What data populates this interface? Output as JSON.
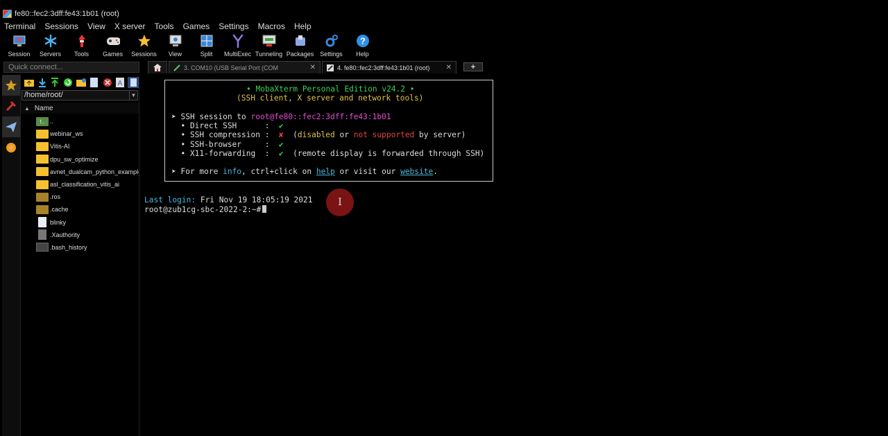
{
  "window": {
    "title": "fe80::fec2:3dff:fe43:1b01 (root)"
  },
  "menu": [
    "Terminal",
    "Sessions",
    "View",
    "X server",
    "Tools",
    "Games",
    "Settings",
    "Macros",
    "Help"
  ],
  "toolbar": [
    {
      "label": "Session",
      "icon": "session-icon"
    },
    {
      "label": "Servers",
      "icon": "servers-icon"
    },
    {
      "label": "Tools",
      "icon": "tools-icon"
    },
    {
      "label": "Games",
      "icon": "games-icon"
    },
    {
      "label": "Sessions",
      "icon": "star-icon"
    },
    {
      "label": "View",
      "icon": "view-icon"
    },
    {
      "label": "Split",
      "icon": "split-icon"
    },
    {
      "label": "MultiExec",
      "icon": "multiexec-icon"
    },
    {
      "label": "Tunneling",
      "icon": "tunneling-icon"
    },
    {
      "label": "Packages",
      "icon": "packages-icon"
    },
    {
      "label": "Settings",
      "icon": "settings-icon"
    },
    {
      "label": "Help",
      "icon": "help-icon"
    }
  ],
  "quick_connect": {
    "placeholder": "Quick connect..."
  },
  "tabs": [
    {
      "label": "3. COM10  (USB Serial Port (COM",
      "active": false
    },
    {
      "label": "4. fe80::fec2:3dff:fe43:1b01 (root)",
      "active": true
    }
  ],
  "browser": {
    "path": "/home/root/",
    "column": "Name",
    "files": [
      {
        "name": "..",
        "type": "up"
      },
      {
        "name": "webinar_ws",
        "type": "folder"
      },
      {
        "name": "Vitis-AI",
        "type": "folder"
      },
      {
        "name": "dpu_sw_optimize",
        "type": "folder"
      },
      {
        "name": "avnet_dualcam_python_example",
        "type": "folder"
      },
      {
        "name": "asl_classification_vitis_ai",
        "type": "folder"
      },
      {
        "name": ".ros",
        "type": "hidden-folder"
      },
      {
        "name": ".cache",
        "type": "hidden-folder"
      },
      {
        "name": "blinky",
        "type": "file"
      },
      {
        "name": ".Xauthority",
        "type": "hidden-file"
      },
      {
        "name": ".bash_history",
        "type": "history-file"
      }
    ]
  },
  "terminal": {
    "banner_title": "• MobaXterm Personal Edition v24.2 •",
    "banner_subtitle": "(SSH client, X server and network tools)",
    "ssh_prefix": "➤ SSH session to ",
    "ssh_target": "root@fe80::fec2:3dff:fe43:1b01",
    "direct_ssh": "  • Direct SSH      :  ",
    "compression": "  • SSH compression :  ",
    "browser": "  • SSH-browser     :  ",
    "x11": "  • X11-forwarding  :  ",
    "check": "✔",
    "cross": "✘",
    "compression_note_1": "  (",
    "compression_disabled": "disabled",
    "compression_note_2": " or ",
    "compression_notsupported": "not supported",
    "compression_note_3": " by server)",
    "x11_note": "  (remote display is forwarded through SSH)",
    "more_prefix": "➤ For more ",
    "more_info": "info",
    "more_mid": ", ctrl+click on ",
    "more_help": "help",
    "more_mid2": " or visit our ",
    "more_site": "website",
    "more_end": ".",
    "last_login_label": "Last login:",
    "last_login_value": " Fri Nov 19 18:05:19 2021",
    "prompt": "root@zub1cg-sbc-2022-2:~#"
  },
  "colors": {
    "accent_green": "#39d353",
    "magenta": "#e04cd0",
    "cyan": "#49b7e0",
    "red": "#e54545"
  }
}
